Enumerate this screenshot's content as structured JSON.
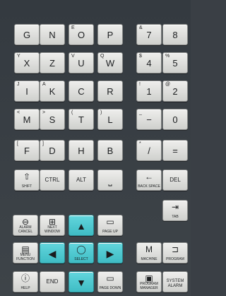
{
  "keys": {
    "g": {
      "main": "G",
      "alt": ""
    },
    "n": {
      "main": "N",
      "alt": ""
    },
    "o": {
      "main": "O",
      "alt": "E"
    },
    "p": {
      "main": "P",
      "alt": ""
    },
    "seven": {
      "main": "7",
      "alt": "&"
    },
    "eight": {
      "main": "8",
      "alt": ""
    },
    "x": {
      "main": "X",
      "alt": "Y"
    },
    "z": {
      "main": "Z",
      "alt": ""
    },
    "u": {
      "main": "U",
      "alt": "V"
    },
    "w": {
      "main": "W",
      "alt": "Q"
    },
    "four": {
      "main": "4",
      "alt": "$"
    },
    "five": {
      "main": "5",
      "alt": "%"
    },
    "i": {
      "main": "I",
      "alt": "J"
    },
    "k": {
      "main": "K",
      "alt": "A"
    },
    "c": {
      "main": "C",
      "alt": ""
    },
    "r": {
      "main": "R",
      "alt": ""
    },
    "one": {
      "main": "1",
      "alt": "!"
    },
    "two": {
      "main": "2",
      "alt": "@"
    },
    "m": {
      "main": "M",
      "alt": "<"
    },
    "s": {
      "main": "S",
      "alt": ">"
    },
    "t": {
      "main": "T",
      "alt": "("
    },
    "l": {
      "main": "L",
      "alt": ")"
    },
    "minus": {
      "main": "−",
      "alt": "_"
    },
    "zero": {
      "main": "0",
      "alt": ""
    },
    "f": {
      "main": "F",
      "alt": "["
    },
    "d": {
      "main": "D",
      "alt": "]"
    },
    "h": {
      "main": "H",
      "alt": ""
    },
    "b": {
      "main": "B",
      "alt": ""
    },
    "slash": {
      "main": "/",
      "alt": "*"
    },
    "equals": {
      "main": "=",
      "alt": ""
    },
    "shift": {
      "icon": "⇧",
      "label": "SHIFT"
    },
    "ctrl": {
      "label": "CTRL"
    },
    "alt": {
      "label": "ALT"
    },
    "space": {
      "icon": "⎵"
    },
    "backspace": {
      "icon": "←",
      "label": "BACK SPACE"
    },
    "del": {
      "label": "DEL"
    },
    "tab": {
      "icon": "⇥",
      "label": "TAB"
    },
    "alarm_cancel": {
      "icon": "⊖",
      "label": "ALARM CANCEL"
    },
    "next_window": {
      "icon": "⊞",
      "label": "NEXT WINDOW"
    },
    "up": {
      "icon": "▲"
    },
    "page_up": {
      "icon": "▭",
      "label": "PAGE UP"
    },
    "menu_function": {
      "icon": "▤",
      "label": "MENU FUNCTION"
    },
    "left": {
      "icon": "◀"
    },
    "select": {
      "icon": "◯",
      "label": "SELECT"
    },
    "right": {
      "icon": "▶"
    },
    "machine": {
      "icon": "M",
      "label": "MACHINE"
    },
    "program": {
      "icon": "⊐",
      "label": "PROGRAM"
    },
    "help": {
      "icon": "ⓘ",
      "label": "HELP"
    },
    "end": {
      "label": "END"
    },
    "down": {
      "icon": "▼"
    },
    "page_down": {
      "icon": "▭",
      "label": "PAGE DOWN"
    },
    "program_manager": {
      "icon": "▣",
      "label": "PROGRAM MANAGER"
    },
    "system_alarm": {
      "label": "SYSTEM ALARM"
    }
  }
}
